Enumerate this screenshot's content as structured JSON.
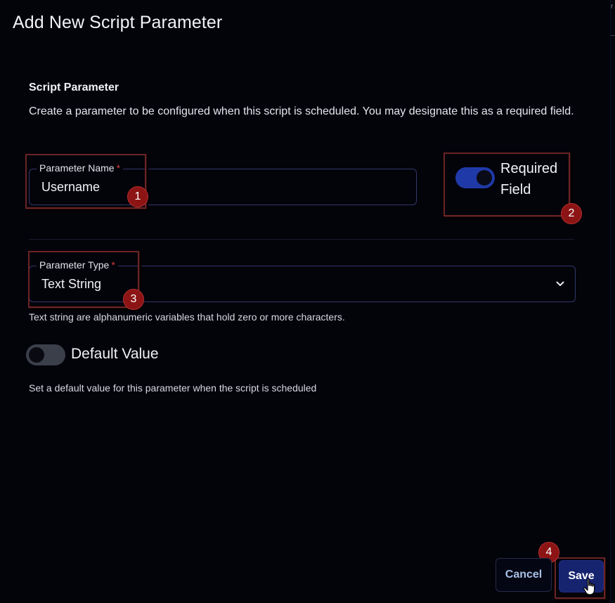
{
  "dialog": {
    "title": "Add New Script Parameter"
  },
  "section": {
    "heading": "Script Parameter",
    "description": "Create a parameter to be configured when this script is scheduled. You may designate this as a required field."
  },
  "parameter_name": {
    "label": "Parameter Name",
    "required_marker": "*",
    "value": "Username"
  },
  "required_field": {
    "label": "Required Field",
    "enabled": true
  },
  "parameter_type": {
    "label": "Parameter Type",
    "required_marker": "*",
    "selected": "Text String",
    "helper_text": "Text string are alphanumeric variables that hold zero or more characters."
  },
  "default_value": {
    "label": "Default Value",
    "enabled": false,
    "helper_text": "Set a default value for this parameter when the script is scheduled"
  },
  "actions": {
    "cancel_label": "Cancel",
    "save_label": "Save"
  },
  "annotations": {
    "step_1": "1",
    "step_2": "2",
    "step_3": "3",
    "step_4": "4"
  },
  "edge_sliver": "r",
  "colors": {
    "background": "#03030a",
    "accent": "#1f3aa8",
    "save_button": "#16236e",
    "annotation_badge": "#8c1414",
    "required_marker": "#d63a3a"
  },
  "icons": {
    "type_dropdown": "chevron-down-icon",
    "cursor": "hand-pointer-cursor-icon"
  }
}
